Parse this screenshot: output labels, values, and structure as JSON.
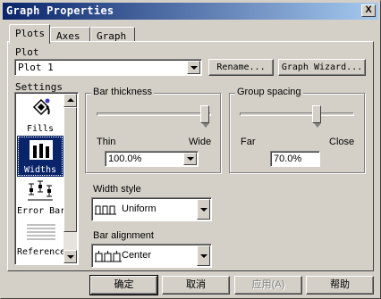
{
  "window": {
    "title": "Graph Properties",
    "close_glyph": "X"
  },
  "tabs": [
    {
      "label": "Plots",
      "active": true
    },
    {
      "label": "Axes",
      "active": false
    },
    {
      "label": "Graph",
      "active": false
    }
  ],
  "plot": {
    "label": "Plot",
    "selected": "Plot 1",
    "rename_label": "Rename...",
    "wizard_label": "Graph Wizard..."
  },
  "settings": {
    "label": "Settings",
    "items": [
      {
        "label": "Fills",
        "icon": "fill-bucket-icon"
      },
      {
        "label": "Widths",
        "icon": "bar-widths-icon",
        "selected": true
      },
      {
        "label": "Error Bars",
        "icon": "error-bars-icon"
      },
      {
        "label": "Reference",
        "icon": "reference-lines-icon"
      }
    ],
    "scroll_position": 0.0
  },
  "bar_thickness": {
    "title": "Bar thickness",
    "min_label": "Thin",
    "max_label": "Wide",
    "value": "100.0%",
    "slider_fraction": 1.0
  },
  "group_spacing": {
    "title": "Group spacing",
    "min_label": "Far",
    "max_label": "Close",
    "value": "70.0%",
    "slider_fraction": 0.7
  },
  "width_style": {
    "label": "Width style",
    "value": "Uniform"
  },
  "bar_alignment": {
    "label": "Bar alignment",
    "value": "Center"
  },
  "buttons": {
    "ok": "确定",
    "cancel": "取消",
    "apply": "应用(A)",
    "help": "帮助"
  },
  "colors": {
    "title_start": "#0a246a",
    "title_end": "#a6caf0",
    "selection": "#0a246a",
    "face": "#d4d0c8"
  }
}
